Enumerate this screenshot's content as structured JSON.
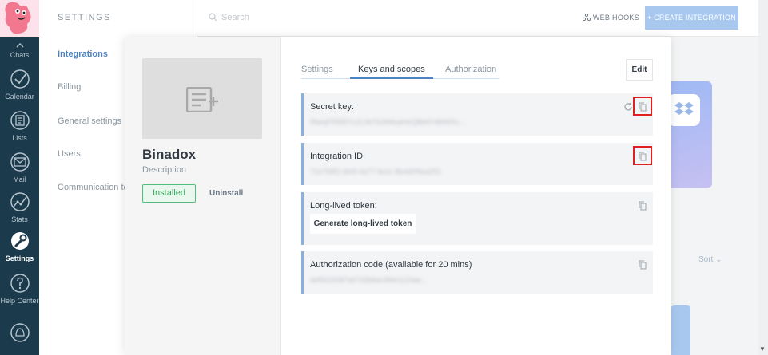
{
  "nav": {
    "items": [
      {
        "label": "Chats"
      },
      {
        "label": "Calendar"
      },
      {
        "label": "Lists"
      },
      {
        "label": "Mail"
      },
      {
        "label": "Stats"
      },
      {
        "label": "Settings"
      },
      {
        "label": "Help Center"
      }
    ]
  },
  "sidebar": {
    "title": "SETTINGS",
    "items": [
      {
        "label": "Integrations"
      },
      {
        "label": "Billing"
      },
      {
        "label": "General settings"
      },
      {
        "label": "Users"
      },
      {
        "label": "Communication to"
      }
    ]
  },
  "topbar": {
    "search_placeholder": "Search",
    "webhooks_label": "WEB HOOKS",
    "create_label": "+ CREATE INTEGRATION"
  },
  "background": {
    "sort_label": "Sort"
  },
  "modal": {
    "name": "Binadox",
    "description": "Description",
    "installed_label": "Installed",
    "uninstall_label": "Uninstall",
    "tabs": [
      {
        "label": "Settings"
      },
      {
        "label": "Keys and scopes"
      },
      {
        "label": "Authorization"
      }
    ],
    "edit_label": "Edit",
    "fields": {
      "secret_key": {
        "label": "Secret key:",
        "value": "RbeqFR5fDYz1LhkT6JhMsaHeQ8bKFdMWXn..."
      },
      "integration_id": {
        "label": "Integration ID:",
        "value": "71e7b8f2-d64f-4a77-9e1c-8b4d0f9ea251"
      },
      "long_lived_token": {
        "label": "Long-lived token:",
        "button_label": "Generate long-lived token"
      },
      "auth_code": {
        "label": "Authorization code (available for 20 mins)",
        "value": "def5020087a57d3b6ac9f4e1124ae..."
      }
    }
  },
  "colors": {
    "nav_bg": "#1b3a4b",
    "accent": "#4d83c4",
    "installed": "#4fbf79",
    "highlight": "#e02020"
  }
}
